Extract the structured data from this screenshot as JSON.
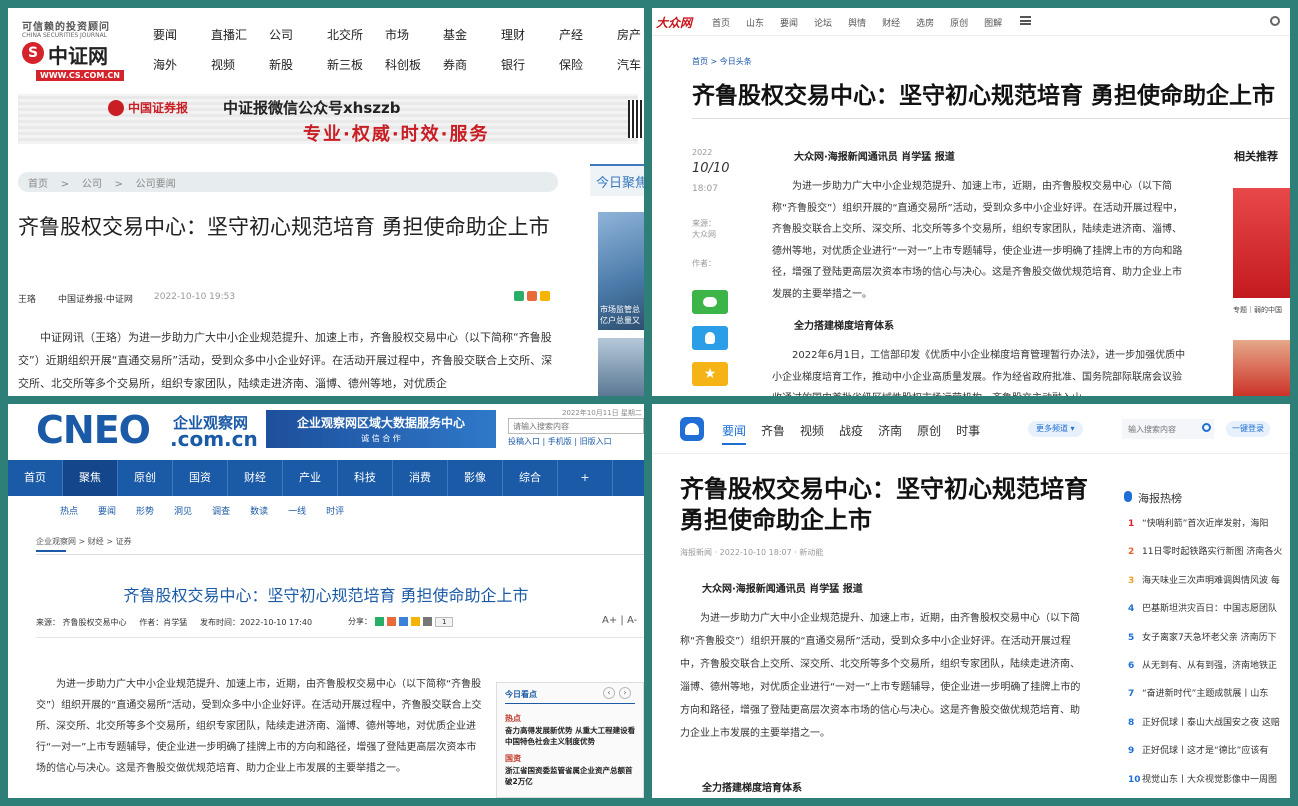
{
  "cs": {
    "slogan": "可信赖的投资顾问",
    "logo_cn": "中证网",
    "logo_en": "CHINA SECURITIES JOURNAL",
    "logo_url": "WWW.CS.COM.CN",
    "nav": [
      "要闻",
      "直播汇",
      "公司",
      "北交所",
      "市场",
      "基金",
      "理财",
      "产经",
      "房产",
      "海外",
      "视频",
      "新股",
      "新三板",
      "科创板",
      "券商",
      "银行",
      "保险",
      "汽车"
    ],
    "banner_brand": "中国证券报",
    "banner_title": "中证报微信公众号xhszzb",
    "banner_slogan": "专业·权威·时效·服务",
    "breadcrumb": [
      "首页",
      ">",
      "公司",
      ">",
      "公司要闻"
    ],
    "side_heading": "今日聚焦",
    "side_caption": "市场监管总 亿户总量又",
    "title": "齐鲁股权交易中心：坚守初心规范培育 勇担使命助企上市",
    "author": "王珞",
    "source": "中国证券报·中证网",
    "time": "2022-10-10 19:53",
    "body": "中证网讯（王珞）为进一步助力广大中小企业规范提升、加速上市，齐鲁股权交易中心（以下简称“齐鲁股交”）近期组织开展“直通交易所”活动，受到众多中小企业好评。在活动开展过程中，齐鲁股交联合上交所、深交所、北交所等多个交易所，组织专家团队，陆续走进济南、淄博、德州等地，对优质企"
  },
  "dz": {
    "logo": "大众网",
    "nav": [
      "首页",
      "山东",
      "要闻",
      "论坛",
      "舆情",
      "财经",
      "选房",
      "原创",
      "图解"
    ],
    "breadcrumb": [
      "首页",
      ">",
      "今日头条"
    ],
    "title": "齐鲁股权交易中心：坚守初心规范培育 勇担使命助企上市",
    "year": "2022",
    "date": "10/10",
    "time": "18:07",
    "source_label": "来源：",
    "source": "大众网",
    "author_label": "作者：",
    "byline": "大众网·海报新闻通讯员 肖学猛 报道",
    "body1": "为进一步助力广大中小企业规范提升、加速上市，近期，由齐鲁股权交易中心（以下简称“齐鲁股交”）组织开展的“直通交易所”活动，受到众多中小企业好评。在活动开展过程中，齐鲁股交联合上交所、深交所、北交所等多个交易所，组织专家团队，陆续走进济南、淄博、德州等地，对优质企业进行“一对一”上市专题辅导，使企业进一步明确了挂牌上市的方向和路径，增强了登陆更高层次资本市场的信心与决心。这是齐鲁股交做优规范培育、助力企业上市发展的主要举措之一。",
    "subhead": "全力搭建梯度培育体系",
    "body2": "2022年6月1日，工信部印发《优质中小企业梯度培育管理暂行办法》，进一步加强优质中小企业梯度培育工作，推动中小企业高质量发展。作为经省政府批准、国务院部际联席会议验收通过的国内首批省级区域性股权市场运营机构，齐鲁股交主动融入山",
    "rec_heading": "相关推荐",
    "rec_caption": "专题｜弱的中国"
  },
  "cneo": {
    "logo": "CNEO",
    "logo_cn": "企业观察网",
    "logo_domain": ".com.cn",
    "banner": "企业观察网区域大数据服务中心",
    "banner_sub": "诚 信 合 作",
    "date": "2022年10月11日 星期二",
    "search_placeholder": "请输入搜索内容",
    "links": [
      "投稿入口",
      "|",
      "手机版",
      "|",
      "旧版入口"
    ],
    "nav": [
      "首页",
      "聚焦",
      "原创",
      "国资",
      "财经",
      "产业",
      "科技",
      "消费",
      "影像",
      "综合",
      "+"
    ],
    "subnav": [
      "热点",
      "要闻",
      "形势",
      "洞见",
      "调查",
      "数读",
      "一线",
      "时评"
    ],
    "breadcrumb": [
      "企业观察网",
      ">",
      "财经",
      ">",
      "证券"
    ],
    "title": "齐鲁股权交易中心：坚守初心规范培育 勇担使命助企上市",
    "source": "来源：  齐鲁股权交易中心",
    "author": "作者：肖学猛",
    "time": "发布时间：2022-10-10 17:40",
    "share": "分享：",
    "share_count": "1",
    "font_big": "A+",
    "font_small": "A-",
    "body": "为进一步助力广大中小企业规范提升、加速上市，近期，由齐鲁股权交易中心（以下简称“齐鲁股交”）组织开展的“直通交易所”活动，受到众多中小企业好评。在活动开展过程中，齐鲁股交联合上交所、深交所、北交所等多个交易所，组织专家团队，陆续走进济南、淄博、德州等地，对优质企业进行“一对一”上市专题辅导，使企业进一步明确了挂牌上市的方向和路径，增强了登陆更高层次资本市场的信心与决心。这是齐鲁股交做优规范培育、助力企业上市发展的主要举措之一。",
    "side_heading": "今日看点",
    "side_tag1": "热点",
    "side_item1": "奋力高得发展新优势 从重大工程建设看中国特色社会主义制度优势",
    "side_tag2": "国资",
    "side_item2": "浙江省国资委监管省属企业资产总额首破2万亿"
  },
  "hb": {
    "nav": [
      "要闻",
      "齐鲁",
      "视频",
      "战疫",
      "济南",
      "原创",
      "时事"
    ],
    "more_channels": "更多频道",
    "search_placeholder": "输入搜索内容",
    "login": "一键登录",
    "title": "齐鲁股权交易中心：坚守初心规范培育 勇担使命助企上市",
    "meta": "海报新闻 · 2022-10-10 18:07 · 新动能",
    "byline": "大众网·海报新闻通讯员 肖学猛 报道",
    "body": "为进一步助力广大中小企业规范提升、加速上市，近期，由齐鲁股权交易中心（以下简称“齐鲁股交”）组织开展的“直通交易所”活动，受到众多中小企业好评。在活动开展过程中，齐鲁股交联合上交所、深交所、北交所等多个交易所，组织专家团队，陆续走进济南、淄博、德州等地，对优质企业进行“一对一”上市专题辅导，使企业进一步明确了挂牌上市的方向和路径，增强了登陆更高层次资本市场的信心与决心。这是齐鲁股交做优规范培育、助力企业上市发展的主要举措之一。",
    "subhead": "全力搭建梯度培育体系",
    "hot_heading": "海报热榜",
    "hot": [
      {
        "n": "1",
        "t": "“快哨利箭”首次近岸发射，海阳"
      },
      {
        "n": "2",
        "t": "11日零时起铁路实行新图 济南各火"
      },
      {
        "n": "3",
        "t": "海天味业三次声明难调舆情风波 每"
      },
      {
        "n": "4",
        "t": "巴基斯坦洪灾百日：中国志愿团队"
      },
      {
        "n": "5",
        "t": "女子离家7天急坏老父亲 济南历下"
      },
      {
        "n": "6",
        "t": "从无到有、从有到强，济南地铁正"
      },
      {
        "n": "7",
        "t": "“奋进新时代”主题成就展丨山东"
      },
      {
        "n": "8",
        "t": "正好侃球丨泰山大战国安之夜 这赔"
      },
      {
        "n": "9",
        "t": "正好侃球丨这才是“德比”应该有"
      },
      {
        "n": "10",
        "t": "视觉山东丨大众视觉影像中一周图"
      }
    ]
  }
}
